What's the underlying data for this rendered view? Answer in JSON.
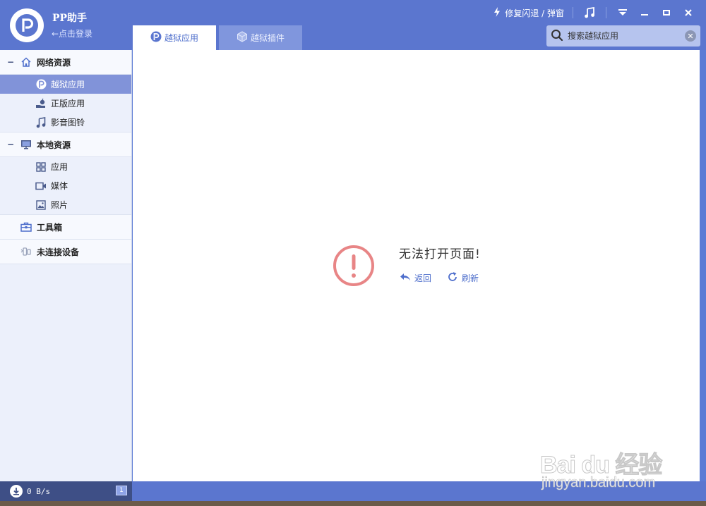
{
  "app": {
    "title": "PP助手",
    "login_text": "←点击登录"
  },
  "top_actions": {
    "repair_label": "修复闪退 / 弹窗"
  },
  "tabs": [
    {
      "label": "越狱应用",
      "active": true
    },
    {
      "label": "越狱插件",
      "active": false
    }
  ],
  "search": {
    "placeholder": "搜索越狱应用"
  },
  "sidebar": {
    "groups": [
      {
        "label": "网络资源",
        "items": [
          {
            "label": "越狱应用",
            "selected": true
          },
          {
            "label": "正版应用"
          },
          {
            "label": "影音图铃"
          }
        ]
      },
      {
        "label": "本地资源",
        "items": [
          {
            "label": "应用"
          },
          {
            "label": "媒体"
          },
          {
            "label": "照片"
          }
        ]
      },
      {
        "label": "工具箱"
      },
      {
        "label": "未连接设备"
      }
    ]
  },
  "content": {
    "error_title": "无法打开页面!",
    "back_label": "返回",
    "refresh_label": "刷新"
  },
  "status": {
    "speed": "0 B/s",
    "badge": "1"
  },
  "watermark": {
    "main": "Bai du 经验",
    "sub": "jingyan.baidu.com"
  },
  "colors": {
    "accent": "#5b76cf",
    "selected": "#8193d9",
    "error": "#e88586"
  }
}
